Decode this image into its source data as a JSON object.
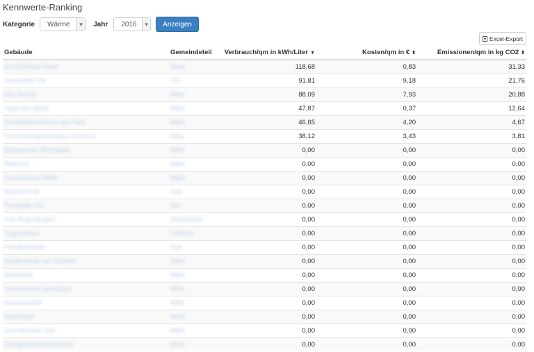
{
  "title": "Kennwerte-Ranking",
  "filters": {
    "kategorie_label": "Kategorie",
    "kategorie_value": "Wärme",
    "jahr_label": "Jahr",
    "jahr_value": "2016",
    "show_button": "Anzeigen"
  },
  "export_label": "Excel-Export",
  "columns": {
    "building": "Gebäude",
    "district": "Gemeindeteil",
    "consumption": "Verbrauch/qm in kWh/Liter",
    "costs": "Kosten/qm in €",
    "emissions": "Emissionen/qm in kg CO2"
  },
  "sort_icons": {
    "consumption": "▼",
    "costs": "⬍",
    "emissions": "⬍"
  },
  "rows": [
    {
      "building": "Grundschule Nord",
      "district": "Nord",
      "consumption": "118,68",
      "costs": "0,83",
      "emissions": "31,33"
    },
    {
      "building": "Sporthalle Ost",
      "district": "Ost",
      "consumption": "91,81",
      "costs": "9,18",
      "emissions": "21,76"
    },
    {
      "building": "Kita Sonne",
      "district": "Mitte",
      "consumption": "88,09",
      "costs": "7,93",
      "emissions": "20,88"
    },
    {
      "building": "Haus am Markt",
      "district": "Mitte",
      "consumption": "47,87",
      "costs": "0,37",
      "emissions": "12,64"
    },
    {
      "building": "Gemeindezentrum am Park",
      "district": "Mitte",
      "consumption": "46,65",
      "costs": "4,20",
      "emissions": "4,67"
    },
    {
      "building": "Feuerwehrgerätehaus Zentrum",
      "district": "Mitte",
      "consumption": "38,12",
      "costs": "3,43",
      "emissions": "3,81"
    },
    {
      "building": "Bürgerhaus Marktplatz",
      "district": "Mitte",
      "consumption": "0,00",
      "costs": "0,00",
      "emissions": "0,00"
    },
    {
      "building": "Rathaus",
      "district": "Mitte",
      "consumption": "0,00",
      "costs": "0,00",
      "emissions": "0,00"
    },
    {
      "building": "Grundschule Mitte",
      "district": "Mitte",
      "consumption": "0,00",
      "costs": "0,00",
      "emissions": "0,00"
    },
    {
      "building": "Bauhof Süd",
      "district": "Süd",
      "consumption": "0,00",
      "costs": "0,00",
      "emissions": "0,00"
    },
    {
      "building": "Turnhalle Ost",
      "district": "Ost",
      "consumption": "0,00",
      "costs": "0,00",
      "emissions": "0,00"
    },
    {
      "building": "Kita Regenbogen",
      "district": "Westviertel",
      "consumption": "0,00",
      "costs": "0,00",
      "emissions": "0,00"
    },
    {
      "building": "Jugendhaus",
      "district": "Feldrain",
      "consumption": "0,00",
      "costs": "0,00",
      "emissions": "0,00"
    },
    {
      "building": "Friedhofshalle",
      "district": "Süd",
      "consumption": "0,00",
      "costs": "0,00",
      "emissions": "0,00"
    },
    {
      "building": "Musikschule am Schloss",
      "district": "Mitte",
      "consumption": "0,00",
      "costs": "0,00",
      "emissions": "0,00"
    },
    {
      "building": "Bibliothek",
      "district": "Mitte",
      "consumption": "0,00",
      "costs": "0,00",
      "emissions": "0,00"
    },
    {
      "building": "Vereinsheim Sportplatz",
      "district": "Mitte",
      "consumption": "0,00",
      "costs": "0,00",
      "emissions": "0,00"
    },
    {
      "building": "Seniorentreff",
      "district": "Mitte",
      "consumption": "0,00",
      "costs": "0,00",
      "emissions": "0,00"
    },
    {
      "building": "Hallenbad",
      "district": "Nord",
      "consumption": "0,00",
      "costs": "0,00",
      "emissions": "0,00"
    },
    {
      "building": "Grundschule Süd",
      "district": "Mitte",
      "consumption": "0,00",
      "costs": "0,00",
      "emissions": "0,00"
    },
    {
      "building": "Dorfgemeinschaftshaus",
      "district": "Mitte",
      "consumption": "0,00",
      "costs": "0,00",
      "emissions": "0,00"
    }
  ]
}
